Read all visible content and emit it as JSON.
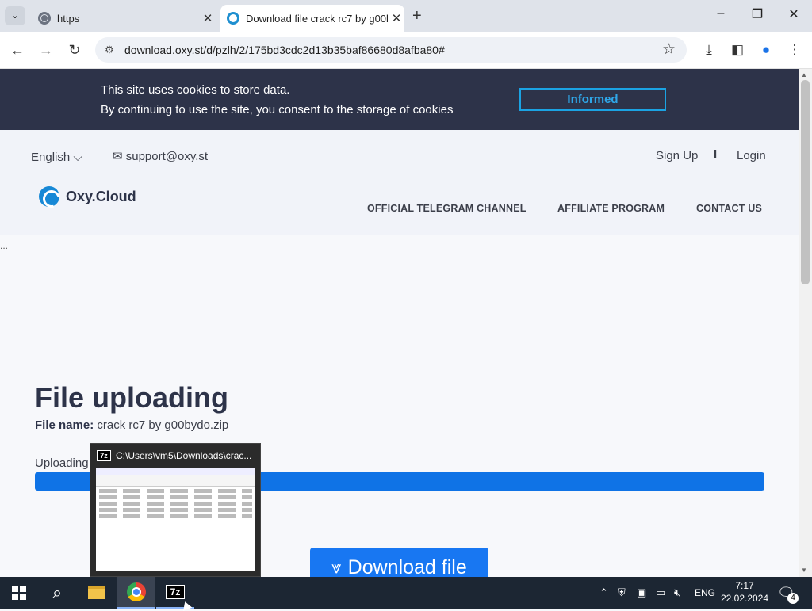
{
  "browser": {
    "tabs": [
      {
        "title": "https"
      },
      {
        "title": "Download file crack rc7 by g00l"
      }
    ],
    "url": "download.oxy.st/d/pzlh/2/175bd3cdc2d13b35baf86680d8afba80#"
  },
  "cookie": {
    "line1": "This site uses cookies to store data.",
    "line2": "By continuing to use the site, you consent to the storage of cookies",
    "button": "Informed"
  },
  "header": {
    "language": "English",
    "email": "support@oxy.st",
    "signup": "Sign Up",
    "separator": "I",
    "login": "Login",
    "logo": "Oxy.Cloud",
    "menu": [
      "OFFICIAL TELEGRAM CHANNEL",
      "AFFILIATE PROGRAM",
      "CONTACT US"
    ]
  },
  "main": {
    "title": "File uploading",
    "file_label": "File name:",
    "file_name": "crack rc7 by g00bydo.zip",
    "uploading_label": "Uploading",
    "progress": 1.0,
    "download_button": "Download file",
    "dots": "..."
  },
  "taskbar": {
    "preview_title": "C:\\Users\\vm5\\Downloads\\crac...",
    "preview_icon": "7z",
    "seven_zip": "7z",
    "lang": "ENG",
    "time": "7:17",
    "date": "22.02.2024",
    "notification_count": "4"
  },
  "colors": {
    "cookie_bg": "#2d3349",
    "accent": "#1877f2",
    "progress": "#0f73e6",
    "informed_border": "#1ba3e3"
  }
}
